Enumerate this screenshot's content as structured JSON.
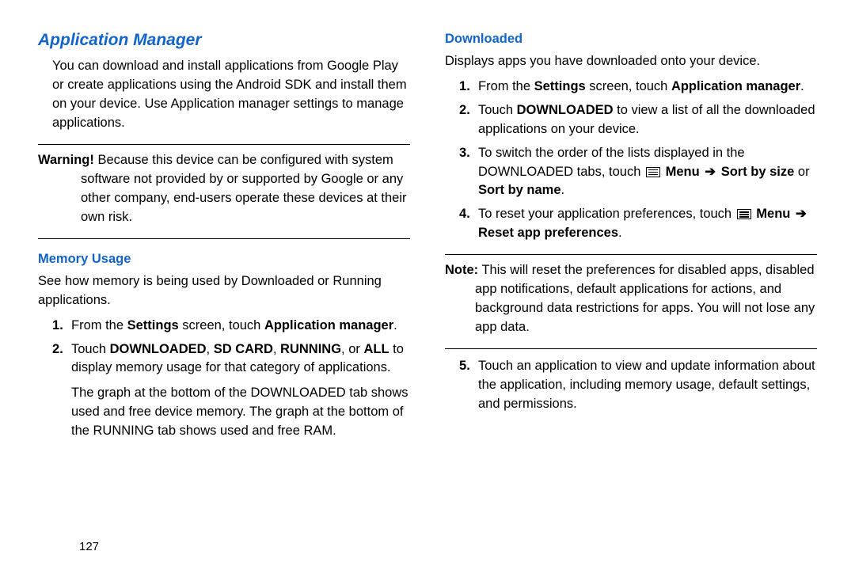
{
  "page_number": "127",
  "left": {
    "section_title": "Application Manager",
    "intro": "You can download and install applications from Google Play or create applications using the Android SDK and install them on your device. Use Application manager settings to manage applications.",
    "warning_label": "Warning!",
    "warning_text": "Because this device can be configured with system software not provided by or supported by Google or any other company, end-users operate these devices at their own risk.",
    "memory_title": "Memory Usage",
    "memory_intro": "See how memory is being used by Downloaded or Running applications.",
    "step1_pre": "From the ",
    "step1_b1": "Settings",
    "step1_mid": " screen, touch ",
    "step1_b2": "Application manager",
    "step1_post": ".",
    "step2_pre": "Touch ",
    "step2_b1": "DOWNLOADED",
    "step2_c1": ", ",
    "step2_b2": "SD CARD",
    "step2_c2": ", ",
    "step2_b3": "RUNNING",
    "step2_c3": ", or ",
    "step2_b4": "ALL",
    "step2_post": " to display memory usage for that category of applications.",
    "step2_extra": "The graph at the bottom of the DOWNLOADED tab shows used and free device memory. The graph at the bottom of the RUNNING tab shows used and free RAM."
  },
  "right": {
    "downloaded_title": "Downloaded",
    "downloaded_intro": "Displays apps you have downloaded onto your device.",
    "step1_pre": "From the ",
    "step1_b1": "Settings",
    "step1_mid": " screen, touch ",
    "step1_b2": "Application manager",
    "step1_post": ".",
    "step2_pre": "Touch ",
    "step2_b1": "DOWNLOADED",
    "step2_post": " to view a list of all the downloaded applications on your device.",
    "step3_pre": "To switch the order of the lists displayed in the DOWNLOADED tabs, touch ",
    "step3_menu": "Menu",
    "step3_arrow": "➔",
    "step3_b1": "Sort by size",
    "step3_mid": " or ",
    "step3_b2": "Sort by name",
    "step3_post": ".",
    "step4_pre": "To reset your application preferences, touch ",
    "step4_menu": "Menu",
    "step4_arrow": "➔",
    "step4_b1": "Reset app preferences",
    "step4_post": ".",
    "note_label": "Note:",
    "note_text": "This will reset the preferences for disabled apps, disabled app notifications, default applications for actions, and background data restrictions for apps. You will not lose any app data.",
    "step5": "Touch an application to view and update information about the application, including memory usage, default settings, and permissions."
  }
}
